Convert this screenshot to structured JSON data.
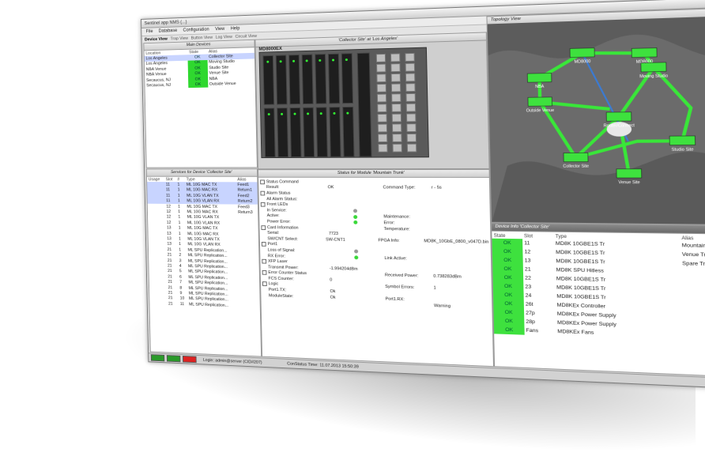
{
  "window": {
    "title": "Sentinel app NMS (...)"
  },
  "menu": [
    "File",
    "Database",
    "Configuration",
    "View",
    "Help"
  ],
  "view_tabs": [
    "Device View",
    "Trap View",
    "Button View",
    "Log View",
    "Circuit View"
  ],
  "main_devices": {
    "title": "Main Devices",
    "columns": [
      "Location",
      "State",
      "Alias"
    ],
    "rows": [
      {
        "location": "Los Angeles",
        "state": "OK",
        "alias": "Collector Site",
        "selected": true
      },
      {
        "location": "Los Angeles",
        "state": "OK",
        "alias": "Moving Studio",
        "selected": false
      },
      {
        "location": "NBA Venue",
        "state": "OK",
        "alias": "Studio Site",
        "selected": false
      },
      {
        "location": "NBA Venue",
        "state": "OK",
        "alias": "Venue Site",
        "selected": false
      },
      {
        "location": "Secaucus, NJ",
        "state": "OK",
        "alias": "NBA",
        "selected": false
      },
      {
        "location": "Secaucus, NJ",
        "state": "OK",
        "alias": "Outside Venue",
        "selected": false
      }
    ]
  },
  "rack_panel": {
    "title": "'Collector Site' at 'Los Angeles'",
    "model": "MD8000EX"
  },
  "topology": {
    "title": "Topology View",
    "nodes": [
      "MD8000",
      "MD8000",
      "Moving Studio",
      "Outside Venue",
      "NBA",
      "Studio Site",
      "Router/Connect",
      "Collector Site",
      "Venue Site"
    ]
  },
  "services": {
    "title": "Services for Device 'Collector Site'",
    "columns": [
      "Usage",
      "Slot",
      "#",
      "Type",
      "Alias"
    ],
    "rows": [
      {
        "usage": "",
        "slot": "11",
        "num": "1",
        "type": "ML 10G MAC TX",
        "alias": "Feed1",
        "sel": true
      },
      {
        "usage": "",
        "slot": "11",
        "num": "1",
        "type": "ML 10G MAC RX",
        "alias": "Return1",
        "sel": true
      },
      {
        "usage": "",
        "slot": "11",
        "num": "1",
        "type": "ML 10G VLAN TX",
        "alias": "Feed2",
        "sel": true
      },
      {
        "usage": "",
        "slot": "11",
        "num": "1",
        "type": "ML 10G VLAN RX",
        "alias": "Return2",
        "sel": true
      },
      {
        "usage": "",
        "slot": "12",
        "num": "1",
        "type": "ML 10G MAC TX",
        "alias": "Feed3",
        "sel": false
      },
      {
        "usage": "",
        "slot": "12",
        "num": "1",
        "type": "ML 10G MAC RX",
        "alias": "Return3",
        "sel": false
      },
      {
        "usage": "",
        "slot": "12",
        "num": "1",
        "type": "ML 10G VLAN TX",
        "alias": "",
        "sel": false
      },
      {
        "usage": "",
        "slot": "12",
        "num": "1",
        "type": "ML 10G VLAN RX",
        "alias": "",
        "sel": false
      },
      {
        "usage": "",
        "slot": "13",
        "num": "1",
        "type": "ML 10G MAC TX",
        "alias": "",
        "sel": false
      },
      {
        "usage": "",
        "slot": "13",
        "num": "1",
        "type": "ML 10G MAC RX",
        "alias": "",
        "sel": false
      },
      {
        "usage": "",
        "slot": "13",
        "num": "1",
        "type": "ML 10G VLAN TX",
        "alias": "",
        "sel": false
      },
      {
        "usage": "",
        "slot": "13",
        "num": "1",
        "type": "ML 10G VLAN RX",
        "alias": "",
        "sel": false
      },
      {
        "usage": "",
        "slot": "21",
        "num": "1",
        "type": "ML SPU Replication...",
        "alias": "",
        "sel": false
      },
      {
        "usage": "",
        "slot": "21",
        "num": "2",
        "type": "ML SPU Replication...",
        "alias": "",
        "sel": false
      },
      {
        "usage": "",
        "slot": "21",
        "num": "3",
        "type": "ML SPU Replication...",
        "alias": "",
        "sel": false
      },
      {
        "usage": "",
        "slot": "21",
        "num": "4",
        "type": "ML SPU Replication...",
        "alias": "",
        "sel": false
      },
      {
        "usage": "",
        "slot": "21",
        "num": "5",
        "type": "ML SPU Replication...",
        "alias": "",
        "sel": false
      },
      {
        "usage": "",
        "slot": "21",
        "num": "6",
        "type": "ML SPU Replication...",
        "alias": "",
        "sel": false
      },
      {
        "usage": "",
        "slot": "21",
        "num": "7",
        "type": "ML SPU Replication...",
        "alias": "",
        "sel": false
      },
      {
        "usage": "",
        "slot": "21",
        "num": "8",
        "type": "ML SPU Replication...",
        "alias": "",
        "sel": false
      },
      {
        "usage": "",
        "slot": "21",
        "num": "9",
        "type": "ML SPU Replication...",
        "alias": "",
        "sel": false
      },
      {
        "usage": "",
        "slot": "21",
        "num": "10",
        "type": "ML SPU Replication...",
        "alias": "",
        "sel": false
      },
      {
        "usage": "",
        "slot": "21",
        "num": "11",
        "type": "ML SPU Replication...",
        "alias": "",
        "sel": false
      }
    ]
  },
  "status": {
    "title": "Status for Module 'Mountain Trunk'",
    "lines": [
      {
        "label": "Status Command",
        "value": "",
        "label2": "",
        "value2": ""
      },
      {
        "label": "Result:",
        "value": "OK",
        "label2": "Command Type:",
        "value2": "r - 5s"
      },
      {
        "label": "Alarm Status",
        "value": "",
        "label2": "",
        "value2": ""
      },
      {
        "label": "All Alarm Status:",
        "value": "",
        "label2": "",
        "value2": ""
      },
      {
        "label": "Front LEDs",
        "value": "",
        "label2": "",
        "value2": ""
      },
      {
        "label": "In Service:",
        "value": "",
        "label2": "",
        "value2": ""
      },
      {
        "label": "Active:",
        "value": "",
        "label2": "Maintenance:",
        "value2": ""
      },
      {
        "label": "Power Error:",
        "value": "",
        "label2": "Error:",
        "value2": ""
      },
      {
        "label": "Card Information",
        "value": "",
        "label2": "Temperature:",
        "value2": ""
      },
      {
        "label": "Serial:",
        "value": "7723",
        "label2": "",
        "value2": ""
      },
      {
        "label": "SW/CNT Select:",
        "value": "SW-CNT1",
        "label2": "FPGA Info:",
        "value2": "MD8K_10GbE_0800_v047D.bin"
      },
      {
        "label": "Port1",
        "value": "",
        "label2": "",
        "value2": ""
      },
      {
        "label": "Loss of Signal:",
        "value": "",
        "label2": "",
        "value2": ""
      },
      {
        "label": "RX Error:",
        "value": "",
        "label2": "Link Active:",
        "value2": ""
      },
      {
        "label": "XFP Laser",
        "value": "",
        "label2": "",
        "value2": ""
      },
      {
        "label": "Transmit Power:",
        "value": "-1.994204dBm",
        "label2": "",
        "value2": ""
      },
      {
        "label": "Error Counter Status",
        "value": "",
        "label2": "Received Power:",
        "value2": "0.738283dBm"
      },
      {
        "label": "FCS Counter:",
        "value": "0",
        "label2": "",
        "value2": ""
      },
      {
        "label": "Logic",
        "value": "",
        "label2": "Symbol Errors:",
        "value2": "1"
      },
      {
        "label": "Port1.TX:",
        "value": "Ok",
        "label2": "",
        "value2": ""
      },
      {
        "label": "ModuleState:",
        "value": "Ok",
        "label2": "Port1.RX:",
        "value2": ""
      },
      {
        "label": "",
        "value": "",
        "label2": "",
        "value2": "Warning"
      }
    ]
  },
  "device_info": {
    "title": "Device Info 'Collector Site'",
    "columns": [
      "State",
      "Slot",
      "Type",
      "Alias"
    ],
    "rows": [
      {
        "state": "OK",
        "slot": "11",
        "type": "MD8K 10GBE1S Tr",
        "alias": "Mountain Trunk"
      },
      {
        "state": "OK",
        "slot": "12",
        "type": "MD8K 10GBE1S Tr",
        "alias": "Venue Trunk"
      },
      {
        "state": "OK",
        "slot": "13",
        "type": "MD8K 10GBE1S Tr",
        "alias": "Spare Trunk"
      },
      {
        "state": "OK",
        "slot": "21",
        "type": "MD8K SPU Hitless",
        "alias": ""
      },
      {
        "state": "OK",
        "slot": "22",
        "type": "MD8K 10GBE1S Tr",
        "alias": ""
      },
      {
        "state": "OK",
        "slot": "23",
        "type": "MD8K 10GBE1S Tr",
        "alias": ""
      },
      {
        "state": "OK",
        "slot": "24",
        "type": "MD8K 10GBE1S Tr",
        "alias": ""
      },
      {
        "state": "OK",
        "slot": "26t",
        "type": "MD8KEx Controller",
        "alias": ""
      },
      {
        "state": "OK",
        "slot": "27p",
        "type": "MD8KEx Power Supply",
        "alias": ""
      },
      {
        "state": "OK",
        "slot": "28p",
        "type": "MD8KEx Power Supply",
        "alias": ""
      },
      {
        "state": "OK",
        "slot": "Fans",
        "type": "MD8KEx Fans",
        "alias": ""
      }
    ]
  },
  "statusbar": {
    "login": "Login: admin@server (CID#207)",
    "time": "ConStatus Time: 11.07.2013 15:50:39"
  },
  "colors": {
    "ok": "#3ee13e",
    "map": "#6b6b6b",
    "link": "#39e639",
    "selected": "#c8d4ff"
  }
}
